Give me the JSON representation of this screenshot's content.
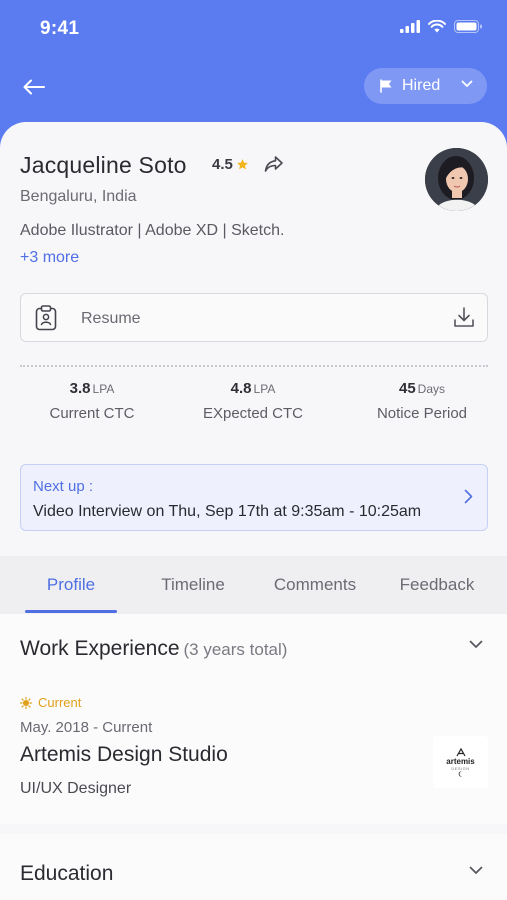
{
  "status_bar": {
    "time": "9:41"
  },
  "header": {
    "status_label": "Hired"
  },
  "candidate": {
    "name": "Jacqueline Soto",
    "rating": "4.5",
    "location": "Bengaluru, India",
    "skills": "Adobe Ilustrator | Adobe XD | Sketch.",
    "more_skills": "+3 more"
  },
  "resume": {
    "label": "Resume"
  },
  "stats": [
    {
      "value": "3.8",
      "unit": "LPA",
      "label": "Current CTC"
    },
    {
      "value": "4.8",
      "unit": "LPA",
      "label": "EXpected CTC"
    },
    {
      "value": "45",
      "unit": "Days",
      "label": "Notice Period"
    }
  ],
  "next_up": {
    "heading": "Next up :",
    "text": "Video Interview on Thu, Sep 17th at 9:35am - 10:25am"
  },
  "tabs": [
    {
      "label": "Profile",
      "active": true
    },
    {
      "label": "Timeline",
      "active": false
    },
    {
      "label": "Comments",
      "active": false
    },
    {
      "label": "Feedback",
      "active": false
    }
  ],
  "work_experience": {
    "title": "Work Experience",
    "subtitle": "(3 years total)",
    "badge": "Current",
    "dates": "May. 2018 - Current",
    "company": "Artemis Design Studio",
    "role": "UI/UX Designer",
    "logo_text": "artemis",
    "logo_subtext": "DESIGN"
  },
  "education": {
    "title": "Education"
  },
  "colors": {
    "brand": "#5b7cf0",
    "accent": "#4f6fe3",
    "current_badge": "#e0a01a"
  }
}
